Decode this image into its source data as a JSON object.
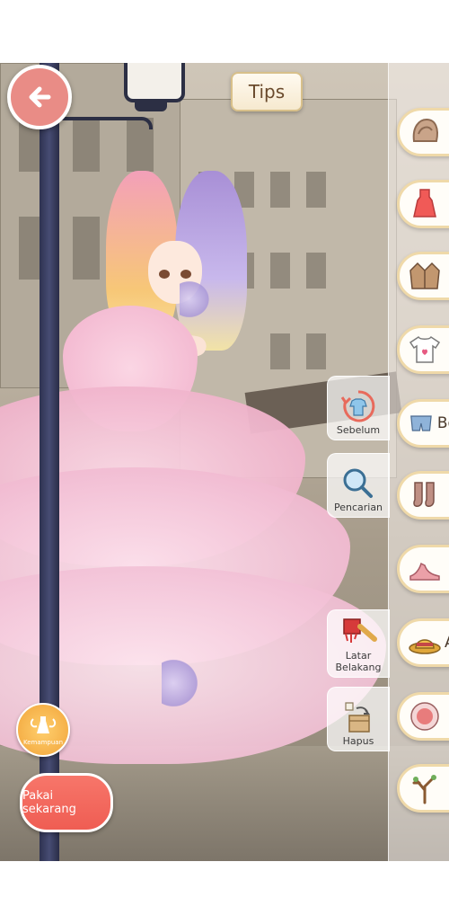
{
  "top_bar": {
    "tips_label": "Tips"
  },
  "categories": [
    {
      "icon": "hair-icon",
      "label": ""
    },
    {
      "icon": "dress-icon",
      "label": ""
    },
    {
      "icon": "coat-icon",
      "label": ""
    },
    {
      "icon": "top-icon",
      "label": ""
    },
    {
      "icon": "bottom-icon",
      "label": "Be"
    },
    {
      "icon": "socks-icon",
      "label": ""
    },
    {
      "icon": "shoes-icon",
      "label": ""
    },
    {
      "icon": "accessory-icon",
      "label": "A"
    },
    {
      "icon": "makeup-icon",
      "label": ""
    },
    {
      "icon": "item-icon",
      "label": ""
    }
  ],
  "tools": {
    "previous_label": "Sebelum",
    "search_label": "Pencarian",
    "background_label": "Latar Belakang",
    "remove_label": "Hapus"
  },
  "ability_label": "Kemampuan",
  "wear_now_label": "Pakai sekarang",
  "colors": {
    "accent": "#ef5d53",
    "back_button": "#e98c86",
    "panel_border": "#efd9a9"
  }
}
